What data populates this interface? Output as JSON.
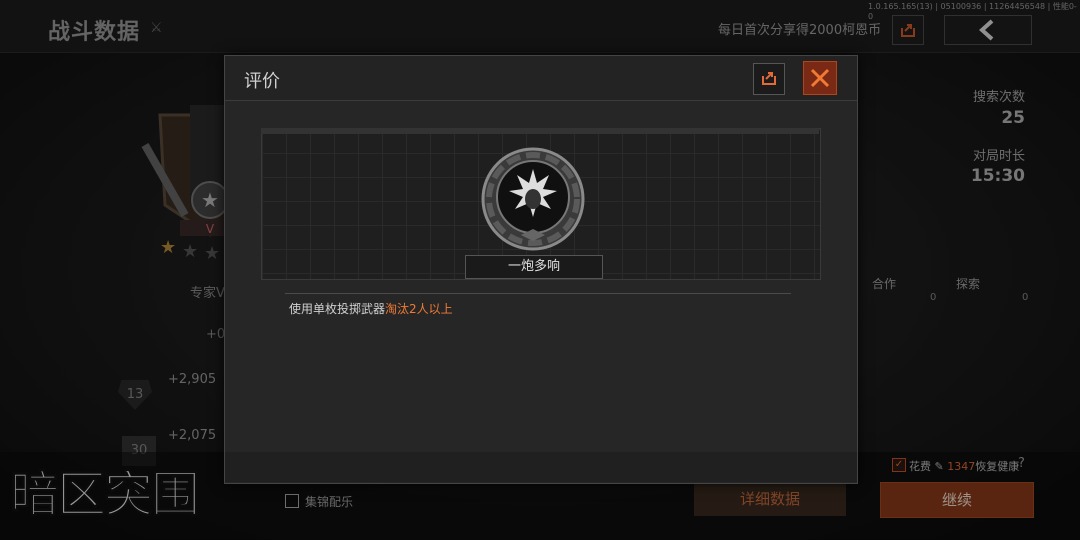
{
  "header": {
    "title": "战斗数据",
    "share_hint": "每日首次分享得2000柯恩币",
    "version": "1.0.165.165(13) | 05100936 | 11264456548 | 性能0-0"
  },
  "left_panel": {
    "rank_label": "专家V",
    "rank_roman": "V",
    "plus_value": "+0",
    "level_rows": [
      {
        "level": "13",
        "value": "+2,905"
      },
      {
        "level": "30",
        "value": "+2,075"
      }
    ]
  },
  "right_panel": {
    "search_label": "搜索次数",
    "search_value": "25",
    "duration_label": "对局时长",
    "duration_value": "15:30",
    "coop_label": "合作",
    "coop_value": "0",
    "explore_label": "探索",
    "explore_value": "0"
  },
  "bottom": {
    "logo": "暗区突围",
    "music_label": "集锦配乐",
    "details_label": "详细数据",
    "continue_label": "继续",
    "heal_prefix": "花费",
    "heal_cost": "1347",
    "heal_suffix": "恢复健康",
    "help": "?"
  },
  "modal": {
    "title": "评价",
    "medal_name": "一炮多响",
    "desc_prefix": "使用单枚投掷武器",
    "desc_highlight": "淘汰2人以上"
  },
  "colors": {
    "accent": "#f07a34",
    "close_bg": "#7a2a14",
    "continue_bg": "#8a3a1a"
  }
}
